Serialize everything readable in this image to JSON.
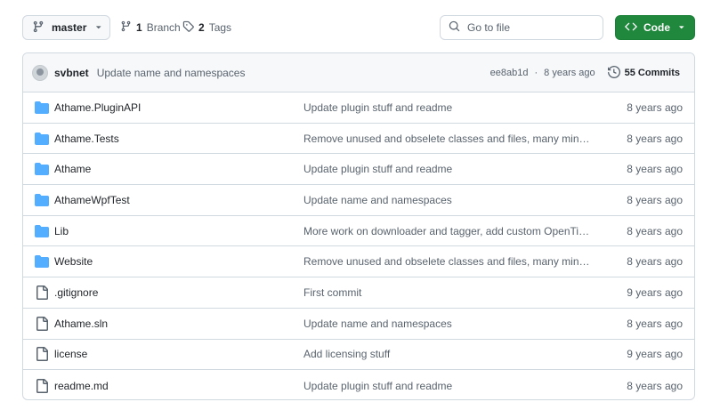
{
  "colors": {
    "accent_green": "#1f883d",
    "folder_blue": "#54aeff",
    "muted_text": "#59636e",
    "border": "#d1d9e0"
  },
  "toolbar": {
    "branch": {
      "name": "master",
      "icon": "git-branch-icon",
      "dropdown_icon": "triangle-down-icon"
    },
    "branches": {
      "count": "1",
      "label": "Branch",
      "icon": "git-branch-icon"
    },
    "tags": {
      "count": "2",
      "label": "Tags",
      "icon": "tag-icon"
    },
    "search": {
      "placeholder": "Go to file",
      "value": "",
      "icon": "search-icon"
    },
    "code_button": {
      "label": "Code",
      "icon": "code-icon",
      "dropdown_icon": "triangle-down-icon"
    }
  },
  "latest_commit": {
    "author": "svbnet",
    "message": "Update name and namespaces",
    "sha": "ee8ab1d",
    "separator": "·",
    "age": "8 years ago",
    "commits_count": "55 Commits",
    "history_icon": "history-icon"
  },
  "files": [
    {
      "type": "folder",
      "icon": "folder-icon",
      "name": "Athame.PluginAPI",
      "message": "Update plugin stuff and readme",
      "age": "8 years ago"
    },
    {
      "type": "folder",
      "icon": "folder-icon",
      "name": "Athame.Tests",
      "message": "Remove unused and obselete classes and files, many minor …",
      "age": "8 years ago"
    },
    {
      "type": "folder",
      "icon": "folder-icon",
      "name": "Athame",
      "message": "Update plugin stuff and readme",
      "age": "8 years ago"
    },
    {
      "type": "folder",
      "icon": "folder-icon",
      "name": "AthameWpfTest",
      "message": "Update name and namespaces",
      "age": "8 years ago"
    },
    {
      "type": "folder",
      "icon": "folder-icon",
      "name": "Lib",
      "message": "More work on downloader and tagger, add custom OpenTid…",
      "age": "8 years ago"
    },
    {
      "type": "folder",
      "icon": "folder-icon",
      "name": "Website",
      "message": "Remove unused and obselete classes and files, many minor …",
      "age": "8 years ago"
    },
    {
      "type": "file",
      "icon": "file-icon",
      "name": ".gitignore",
      "message": "First commit",
      "age": "9 years ago"
    },
    {
      "type": "file",
      "icon": "file-icon",
      "name": "Athame.sln",
      "message": "Update name and namespaces",
      "age": "8 years ago"
    },
    {
      "type": "file",
      "icon": "file-icon",
      "name": "license",
      "message": "Add licensing stuff",
      "age": "9 years ago"
    },
    {
      "type": "file",
      "icon": "file-icon",
      "name": "readme.md",
      "message": "Update plugin stuff and readme",
      "age": "8 years ago"
    }
  ]
}
